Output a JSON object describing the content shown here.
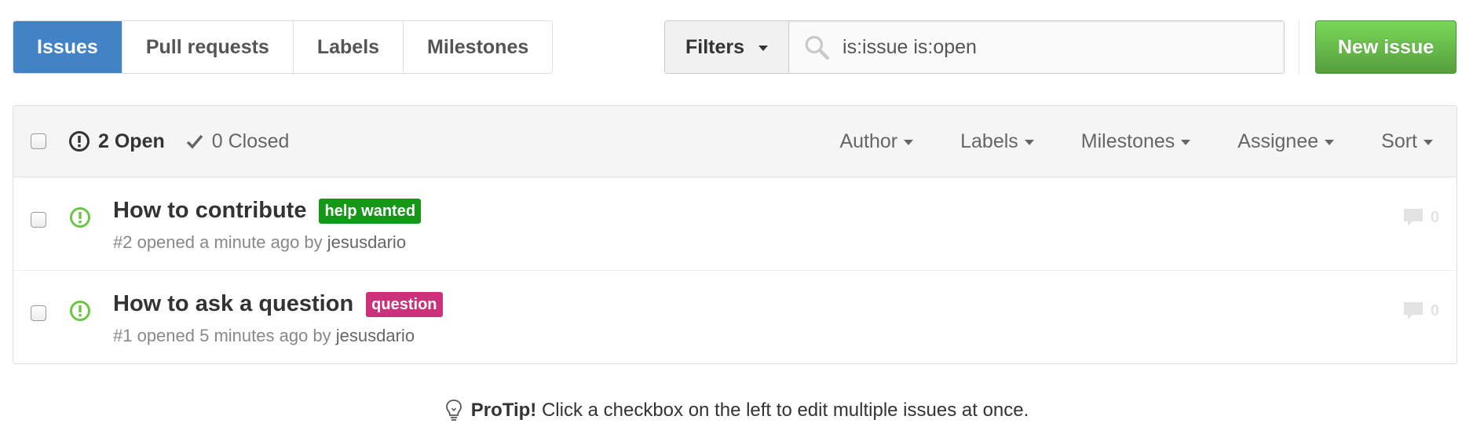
{
  "subnav": {
    "items": [
      {
        "label": "Issues",
        "active": true
      },
      {
        "label": "Pull requests",
        "active": false
      },
      {
        "label": "Labels",
        "active": false
      },
      {
        "label": "Milestones",
        "active": false
      }
    ]
  },
  "search": {
    "filters_label": "Filters",
    "value": "is:issue is:open",
    "icon": "search-icon"
  },
  "new_issue_label": "New issue",
  "colors": {
    "accent": "#4183c4",
    "new_issue_green": "#6cc644",
    "open_icon_green": "#6cc644",
    "help_wanted": "#159818",
    "question": "#cc317c"
  },
  "header": {
    "open_label": "2 Open",
    "closed_label": "0 Closed",
    "filters": [
      "Author",
      "Labels",
      "Milestones",
      "Assignee",
      "Sort"
    ]
  },
  "issues": [
    {
      "title": "How to contribute",
      "label": "help wanted",
      "label_color": "#159818",
      "meta_prefix": "#2 opened a minute ago by",
      "author": "jesusdario",
      "comments": "0"
    },
    {
      "title": "How to ask a question",
      "label": "question",
      "label_color": "#cc317c",
      "meta_prefix": "#1 opened 5 minutes ago by",
      "author": "jesusdario",
      "comments": "0"
    }
  ],
  "protip": {
    "lead": "ProTip!",
    "text": "Click a checkbox on the left to edit multiple issues at once."
  }
}
